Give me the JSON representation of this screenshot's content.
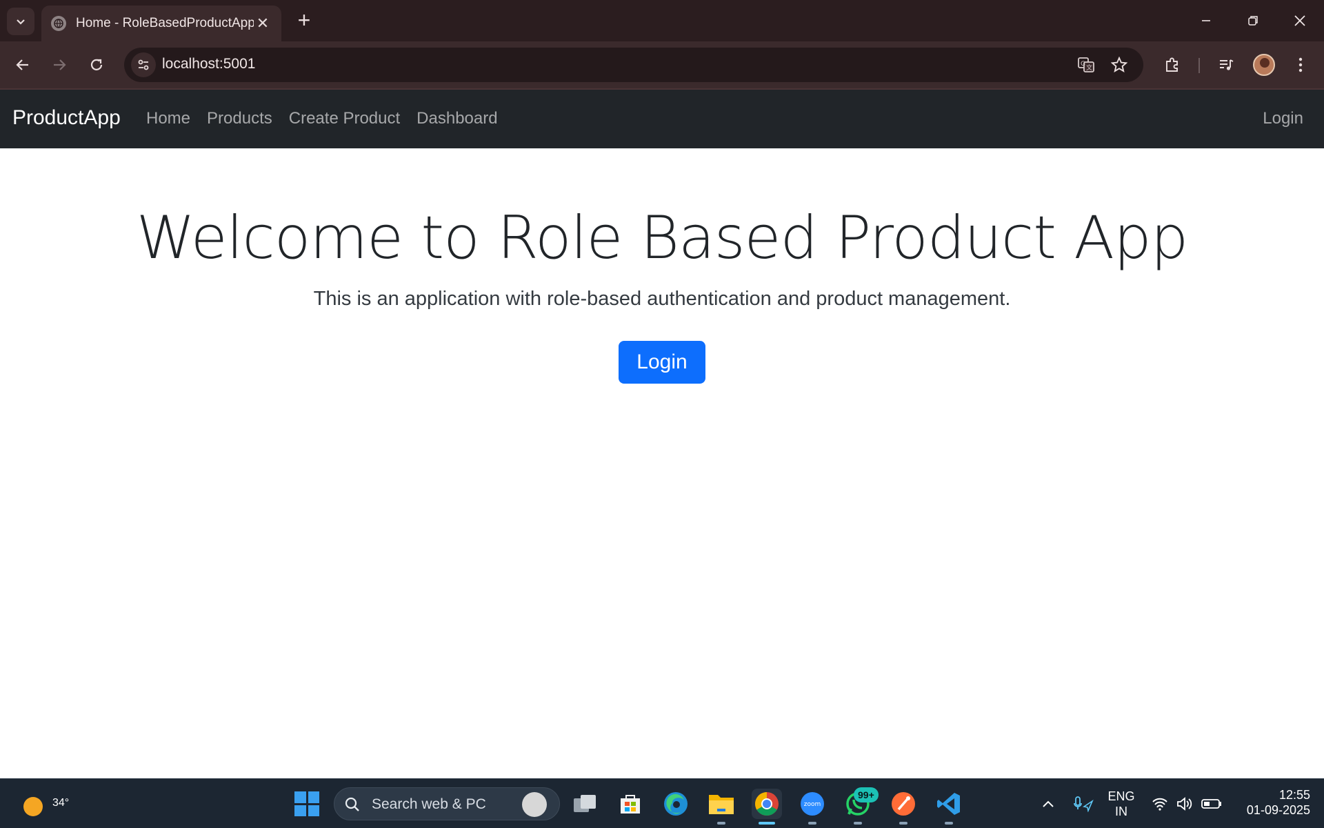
{
  "browser": {
    "tab_title": "Home - RoleBasedProductApp",
    "url": "localhost:5001"
  },
  "app": {
    "brand": "ProductApp",
    "nav": [
      "Home",
      "Products",
      "Create Product",
      "Dashboard"
    ],
    "login_link": "Login"
  },
  "hero": {
    "title": "Welcome to Role Based Product App",
    "subtitle": "This is an application with role-based authentication and product management.",
    "button": "Login"
  },
  "taskbar": {
    "weather_temp": "34°",
    "search_placeholder": "Search web & PC",
    "whatsapp_badge": "99+",
    "language": "ENG",
    "region": "IN",
    "time": "12:55",
    "date": "01-09-2025"
  },
  "colors": {
    "navbar": "#212529",
    "primary": "#0d6efd",
    "chrome": "#3b2a2c"
  }
}
